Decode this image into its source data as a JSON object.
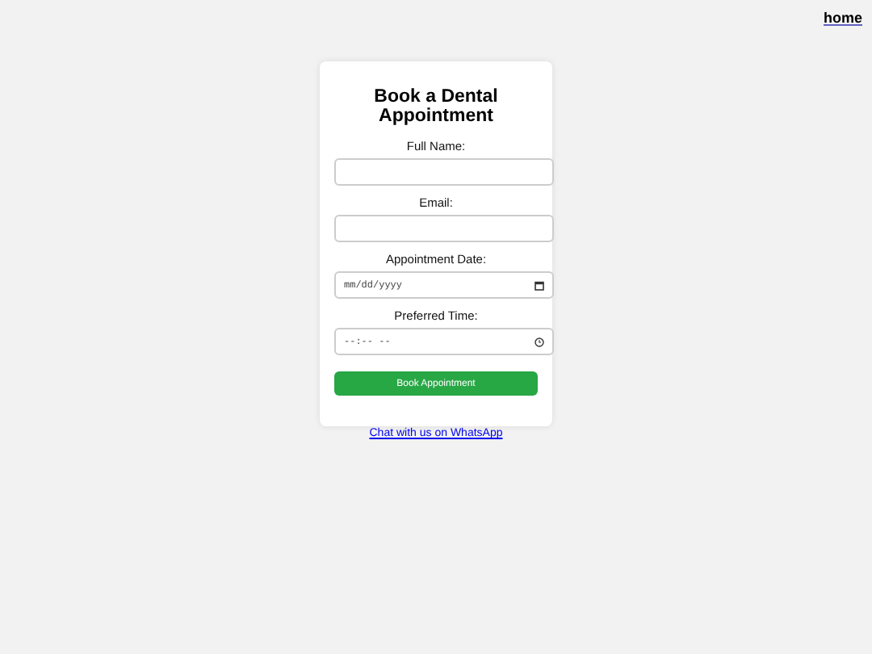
{
  "nav": {
    "home_link": "home"
  },
  "form": {
    "title": "Book a Dental Appointment",
    "fields": [
      {
        "kind": "text",
        "label": "Full Name:"
      },
      {
        "kind": "text",
        "label": "Email:"
      },
      {
        "kind": "date",
        "label": "Appointment Date:",
        "placeholder": "mm/dd/yyyy"
      },
      {
        "kind": "time",
        "label": "Preferred Time:",
        "placeholder": "--:-- --"
      }
    ],
    "submit": "Book Appointment"
  },
  "whatsapp_link": "Chat with us on WhatsApp"
}
